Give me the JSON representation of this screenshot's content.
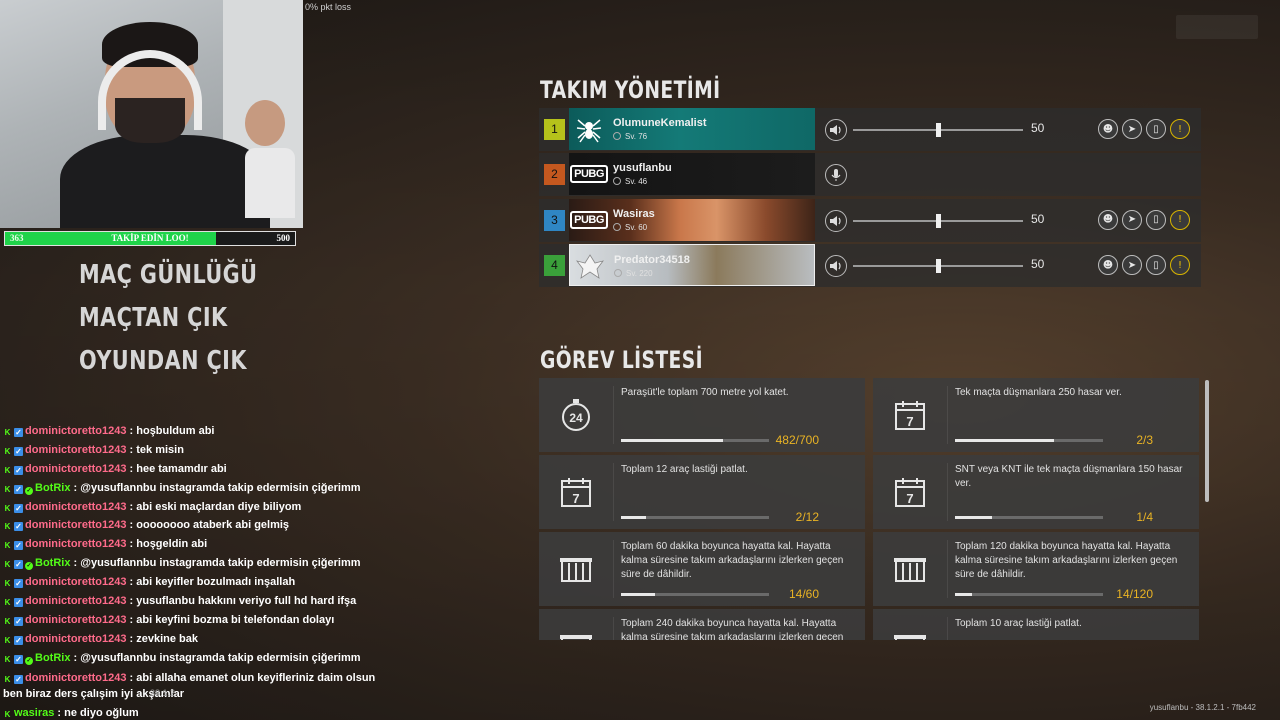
{
  "overlay": {
    "pkt_loss": "0% pkt loss",
    "follow_goal": {
      "current": "363",
      "label": "TAKİP EDİN LOO!",
      "max": "500",
      "fraction": 0.726
    }
  },
  "left_menu": [
    "MAÇ GÜNLÜĞÜ",
    "MAÇTAN ÇIK",
    "OYUNDAN ÇIK"
  ],
  "chat": [
    {
      "user": "dominictoretto1243",
      "user_color": "red",
      "badges": [
        "kick",
        "prime"
      ],
      "message": "hoşbuldum abi"
    },
    {
      "user": "dominictoretto1243",
      "user_color": "red",
      "badges": [
        "kick",
        "prime"
      ],
      "message": "tek misin"
    },
    {
      "user": "dominictoretto1243",
      "user_color": "red",
      "badges": [
        "kick",
        "prime"
      ],
      "message": "hee tamamdır abi"
    },
    {
      "user": "BotRix",
      "user_color": "green",
      "badges": [
        "kick",
        "prime",
        "verified"
      ],
      "message": "@yusuflannbu instagramda takip edermisin çiğerimm"
    },
    {
      "user": "dominictoretto1243",
      "user_color": "red",
      "badges": [
        "kick",
        "prime"
      ],
      "message": "abi eski maçlardan diye biliyom"
    },
    {
      "user": "dominictoretto1243",
      "user_color": "red",
      "badges": [
        "kick",
        "prime"
      ],
      "message": "oooooooo ataberk abi gelmiş"
    },
    {
      "user": "dominictoretto1243",
      "user_color": "red",
      "badges": [
        "kick",
        "prime"
      ],
      "message": "hoşgeldin abi"
    },
    {
      "user": "BotRix",
      "user_color": "green",
      "badges": [
        "kick",
        "prime",
        "verified"
      ],
      "message": "@yusuflannbu instagramda takip edermisin çiğerimm"
    },
    {
      "user": "dominictoretto1243",
      "user_color": "red",
      "badges": [
        "kick",
        "prime"
      ],
      "message": "abi keyifler bozulmadı inşallah"
    },
    {
      "user": "dominictoretto1243",
      "user_color": "red",
      "badges": [
        "kick",
        "prime"
      ],
      "message": "yusuflanbu hakkını veriyo full hd hard ifşa"
    },
    {
      "user": "dominictoretto1243",
      "user_color": "red",
      "badges": [
        "kick",
        "prime"
      ],
      "message": "abi keyfini bozma bi telefondan dolayı"
    },
    {
      "user": "dominictoretto1243",
      "user_color": "red",
      "badges": [
        "kick",
        "prime"
      ],
      "message": "zevkine bak"
    },
    {
      "user": "BotRix",
      "user_color": "green",
      "badges": [
        "kick",
        "prime",
        "verified"
      ],
      "message": "@yusuflannbu instagramda takip edermisin çiğerimm"
    },
    {
      "user": "dominictoretto1243",
      "user_color": "red",
      "badges": [
        "kick",
        "prime"
      ],
      "message": "abi allaha emanet olun keyifleriniz daim olsun ben biraz ders çalışim iyi akşamlar"
    },
    {
      "user": "wasiras",
      "user_color": "green",
      "badges": [
        "kick"
      ],
      "message": "ne diyo oğlum"
    }
  ],
  "version_left": "38.1.2",
  "version_right": "yusuflanbu - 38.1.2.1 - 7fb442",
  "team": {
    "title": "TAKIM YÖNETİMİ",
    "members": [
      {
        "slot": "1",
        "slot_color": "#b5c21b",
        "name": "OlumuneKemalist",
        "level": "Sv. 76",
        "emblem": "spider",
        "card_bg": "teal",
        "volume": "50",
        "volume_level": 0.5,
        "muted_icon": false
      },
      {
        "slot": "2",
        "slot_color": "#c4581f",
        "name": "yusuflanbu",
        "level": "Sv. 46",
        "emblem": "pubg",
        "card_bg": "dark",
        "volume": null,
        "volume_level": null,
        "muted_icon": true
      },
      {
        "slot": "3",
        "slot_color": "#2f86c4",
        "name": "Wasiras",
        "level": "Sv. 60",
        "emblem": "pubg",
        "card_bg": "orange",
        "volume": "50",
        "volume_level": 0.5,
        "muted_icon": false
      },
      {
        "slot": "4",
        "slot_color": "#3aa03a",
        "name": "Predator34518",
        "level": "Sv. 220",
        "emblem": "eagle",
        "card_bg": "white",
        "volume": "50",
        "volume_level": 0.5,
        "muted_icon": false
      }
    ]
  },
  "missions": {
    "title": "GÖREV LİSTESİ",
    "items": [
      {
        "icon": "stopwatch-24-icon",
        "text": "Paraşüt'le toplam 700 metre yol katet.",
        "progress": "482/700",
        "fraction": 0.689
      },
      {
        "icon": "calendar-7-icon",
        "text": "Tek maçta düşmanlara 250 hasar ver.",
        "progress": "2/3",
        "fraction": 0.667
      },
      {
        "icon": "calendar-7-icon",
        "text": "Toplam 12 araç lastiği patlat.",
        "progress": "2/12",
        "fraction": 0.167
      },
      {
        "icon": "calendar-7-icon",
        "text": "SNT veya KNT ile tek maçta düşmanlara 150 hasar ver.",
        "progress": "1/4",
        "fraction": 0.25
      },
      {
        "icon": "crate-icon",
        "text": "Toplam 60 dakika boyunca hayatta kal. Hayatta kalma süresine takım arkadaşlarını izlerken geçen süre de dâhildir.",
        "progress": "14/60",
        "fraction": 0.233
      },
      {
        "icon": "crate-icon",
        "text": "Toplam 120 dakika boyunca hayatta kal. Hayatta kalma süresine takım arkadaşlarını izlerken geçen süre de dâhildir.",
        "progress": "14/120",
        "fraction": 0.117
      },
      {
        "icon": "crate-icon",
        "text": "Toplam 240 dakika boyunca hayatta kal. Hayatta kalma süresine takım arkadaşlarını izlerken geçen",
        "progress": "",
        "fraction": 0.05
      },
      {
        "icon": "crate-icon",
        "text": "Toplam 10 araç lastiği patlat.",
        "progress": "",
        "fraction": 0.1
      }
    ]
  }
}
